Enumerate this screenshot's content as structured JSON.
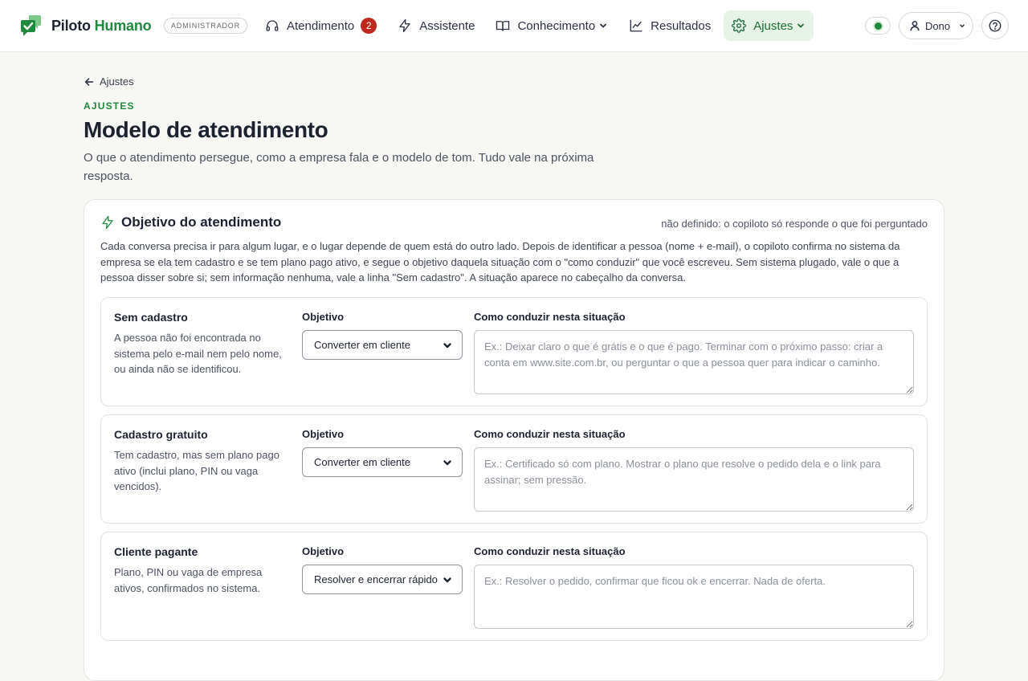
{
  "app": {
    "brand_part1": "Piloto",
    "brand_part2": "Humano",
    "role_badge": "ADMINISTRADOR",
    "accent_color": "#1f8a3e"
  },
  "nav": {
    "items": [
      {
        "label": "Atendimento",
        "icon": "headset-icon",
        "badge": "2"
      },
      {
        "label": "Assistente",
        "icon": "lightning-icon"
      },
      {
        "label": "Conhecimento",
        "icon": "book-icon",
        "dropdown": true
      },
      {
        "label": "Resultados",
        "icon": "chart-line-icon"
      },
      {
        "label": "Ajustes",
        "icon": "gear-icon",
        "dropdown": true,
        "active": true
      }
    ]
  },
  "header_right": {
    "user_label": "Dono",
    "status_color": "#1f8a3e"
  },
  "page": {
    "back_label": "Ajustes",
    "eyebrow": "AJUSTES",
    "title": "Modelo de atendimento",
    "description": "O que o atendimento persegue, como a empresa fala e o modelo de tom. Tudo vale na próxima resposta."
  },
  "card": {
    "title": "Objetivo do atendimento",
    "status": "não definido: o copiloto só responde o que foi perguntado",
    "description": "Cada conversa precisa ir para algum lugar, e o lugar depende de quem está do outro lado. Depois de identificar a pessoa (nome + e-mail), o copiloto confirma no sistema da empresa se ela tem cadastro e se tem plano pago ativo, e segue o objetivo daquela situação com o \"como conduzir\" que você escreveu. Sem sistema plugado, vale o que a pessoa disser sobre si; sem informação nenhuma, vale a linha \"Sem cadastro\". A situação aparece no cabeçalho da conversa.",
    "objective_label": "Objetivo",
    "guide_label": "Como conduzir nesta situação",
    "situations": [
      {
        "name": "Sem cadastro",
        "description": "A pessoa não foi encontrada no sistema pelo e-mail nem pelo nome, ou ainda não se identificou.",
        "objective": "Converter em cliente",
        "guide_placeholder": "Ex.: Deixar claro o que é grátis e o que é pago. Terminar com o próximo passo: criar a conta em www.site.com.br, ou perguntar o que a pessoa quer para indicar o caminho."
      },
      {
        "name": "Cadastro gratuito",
        "description": "Tem cadastro, mas sem plano pago ativo (inclui plano, PIN ou vaga vencidos).",
        "objective": "Converter em cliente",
        "guide_placeholder": "Ex.: Certificado só com plano. Mostrar o plano que resolve o pedido dela e o link para assinar; sem pressão."
      },
      {
        "name": "Cliente pagante",
        "description": "Plano, PIN ou vaga de empresa ativos, confirmados no sistema.",
        "objective": "Resolver e encerrar rápido",
        "guide_placeholder": "Ex.: Resolver o pedido, confirmar que ficou ok e encerrar. Nada de oferta."
      }
    ]
  }
}
